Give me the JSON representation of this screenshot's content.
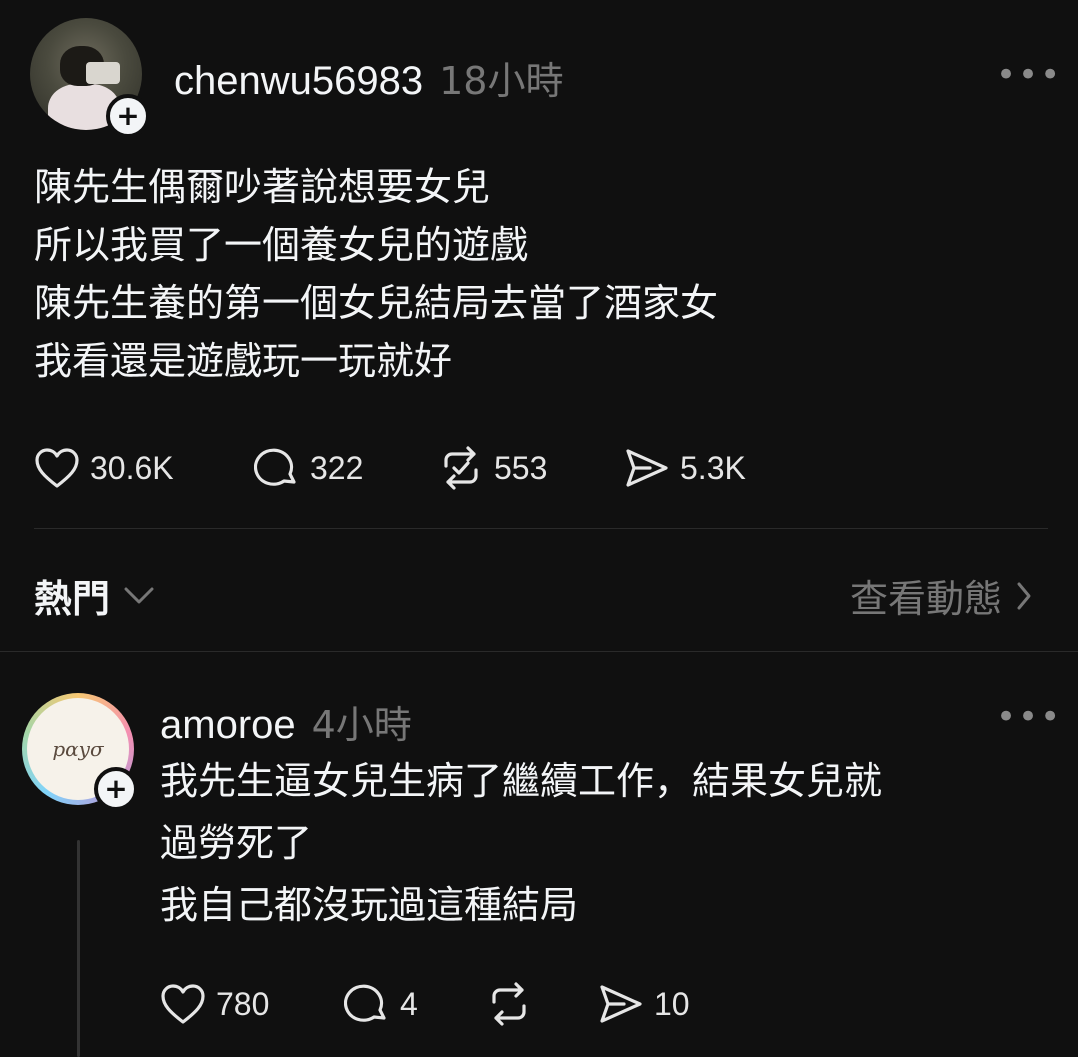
{
  "post": {
    "username": "chenwu56983",
    "time": "18小時",
    "lines": [
      "陳先生偶爾吵著說想要女兒",
      "所以我買了一個養女兒的遊戲",
      "陳先生養的第一個女兒結局去當了酒家女",
      "我看還是遊戲玩一玩就好"
    ],
    "likes": "30.6K",
    "comments": "322",
    "reposts": "553",
    "shares": "5.3K"
  },
  "sort_bar": {
    "sort_label": "熱門",
    "view_activity": "查看動態"
  },
  "reply": {
    "username": "amoroe",
    "time": "4小時",
    "lines": [
      "我先生逼女兒生病了繼續工作，結果女兒就",
      "過勞死了",
      "我自己都沒玩過這種結局"
    ],
    "avatar_text": "pαyσ",
    "likes": "780",
    "comments": "4",
    "shares": "10"
  },
  "icons": {
    "like": "heart-icon",
    "comment": "speech-bubble-icon",
    "repost": "repost-icon",
    "share": "send-icon",
    "more": "more-horizontal-icon"
  }
}
